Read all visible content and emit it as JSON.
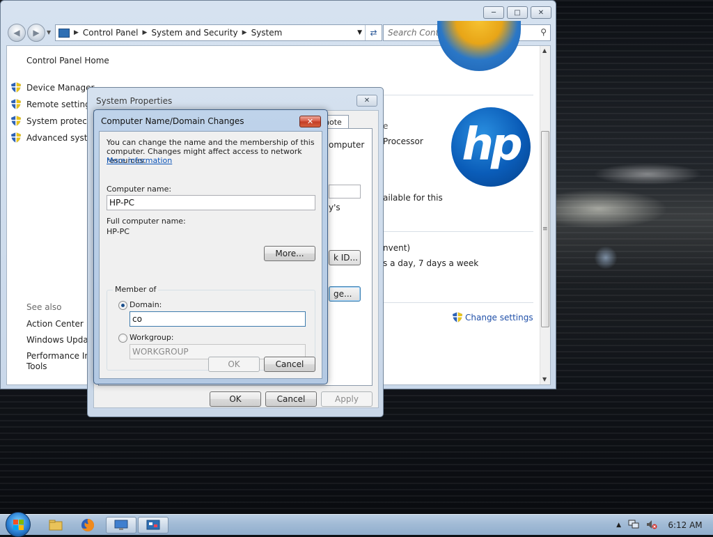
{
  "window": {
    "breadcrumbs": [
      "Control Panel",
      "System and Security",
      "System"
    ],
    "search_placeholder": "Search Control Panel",
    "left_pane": {
      "home": "Control Panel Home",
      "items": [
        "Device Manager",
        "Remote settings",
        "System protectio",
        "Advanced system"
      ],
      "see_also_title": "See also",
      "see_also": [
        "Action Center",
        "Windows Update",
        "Performance Infc",
        "Tools"
      ]
    },
    "main_fragments": {
      "computer": "omputer",
      "processor": "Processor",
      "ys": "y's",
      "available": "ailable for this",
      "event": "nvent)",
      "day": "s a day, 7 days a week",
      "e": "e",
      "change_settings": "Change settings"
    },
    "logo_text": "hp"
  },
  "system_properties": {
    "title": "System Properties",
    "tab_fragment": "note",
    "id_button_fragment": "k ID...",
    "change_button_fragment": "ge...",
    "ok": "OK",
    "cancel": "Cancel",
    "apply": "Apply"
  },
  "computer_name_dialog": {
    "title": "Computer Name/Domain Changes",
    "description": "You can change the name and the membership of this computer. Changes might affect access to network resources.",
    "more_info_link": "More information",
    "computer_name_label": "Computer name:",
    "computer_name_value": "HP-PC",
    "full_name_label": "Full computer name:",
    "full_name_value": "HP-PC",
    "more_button": "More...",
    "member_of_label": "Member of",
    "domain_label": "Domain:",
    "domain_value": "co",
    "workgroup_label": "Workgroup:",
    "workgroup_value": "WORKGROUP",
    "selected_membership": "Domain",
    "ok": "OK",
    "cancel": "Cancel"
  },
  "taskbar": {
    "clock": "6:12 AM",
    "pinned": [
      "windows-explorer-icon",
      "firefox-icon",
      "remote-desktop-icon",
      "control-panel-icon"
    ]
  },
  "colors": {
    "link": "#0c54b8",
    "hp_blue": "#0a5cb8",
    "close_red": "#c23b25"
  }
}
